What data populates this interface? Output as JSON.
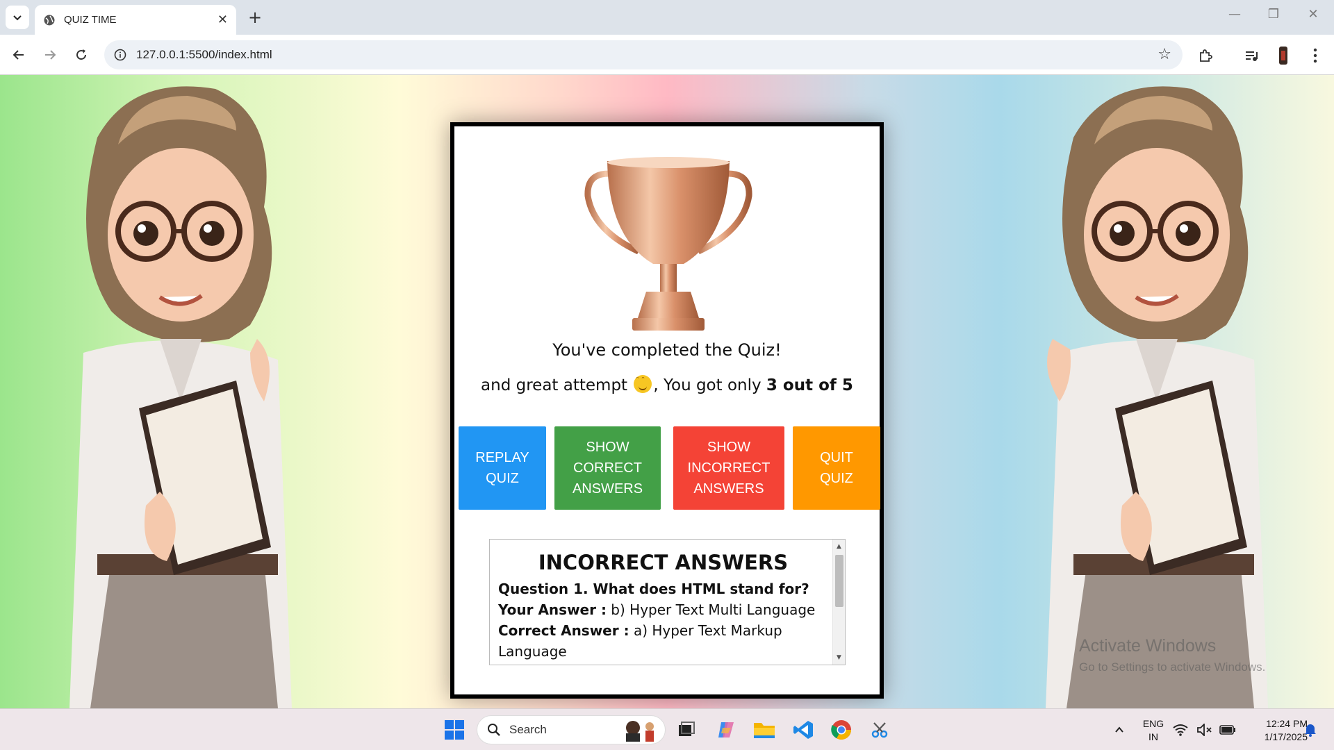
{
  "browser": {
    "tab_title": "QUIZ TIME",
    "url": "127.0.0.1:5500/index.html"
  },
  "quiz": {
    "completed_message": "You've completed the Quiz!",
    "score_prefix": "and great attempt",
    "score_middle": ", You got only",
    "score_value": "3 out of 5",
    "buttons": {
      "replay": "REPLAY\nQUIZ",
      "show_correct": "SHOW\nCORRECT\nANSWERS",
      "show_incorrect": "SHOW\nINCORRECT\nANSWERS",
      "quit": "QUIT\nQUIZ"
    },
    "answers_panel": {
      "heading": "INCORRECT ANSWERS",
      "question": "Question 1. What does HTML stand for?",
      "your_answer_label": "Your Answer :",
      "your_answer": "b) Hyper Text Multi Language",
      "correct_answer_label": "Correct Answer :",
      "correct_answer": "a) Hyper Text Markup Language"
    }
  },
  "watermark": {
    "line1": "Activate Windows",
    "line2": "Go to Settings to activate Windows."
  },
  "taskbar": {
    "search_placeholder": "Search",
    "language": "ENG",
    "region": "IN",
    "time": "12:24 PM",
    "date": "1/17/2025"
  },
  "colors": {
    "replay": "#2196f3",
    "show_correct": "#43a047",
    "show_incorrect": "#f44336",
    "quit": "#ff9800"
  }
}
